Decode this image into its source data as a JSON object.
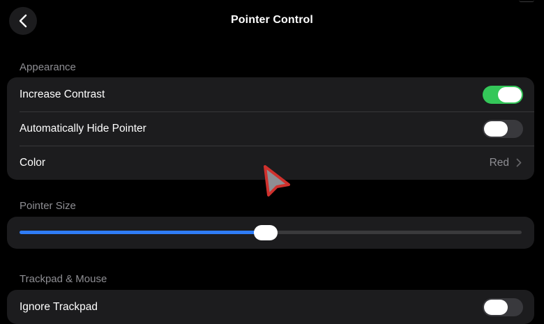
{
  "nav": {
    "title": "Pointer Control",
    "back_icon": "chevron-left-icon"
  },
  "sections": {
    "appearance": {
      "header": "Appearance",
      "increase_contrast": {
        "label": "Increase Contrast",
        "on": true
      },
      "auto_hide_pointer": {
        "label": "Automatically Hide Pointer",
        "on": false
      },
      "color": {
        "label": "Color",
        "value": "Red"
      }
    },
    "pointer_size": {
      "header": "Pointer Size",
      "value_fraction": 0.49
    },
    "trackpad_mouse": {
      "header": "Trackpad & Mouse",
      "ignore_trackpad": {
        "label": "Ignore Trackpad",
        "on": false
      }
    }
  },
  "colors": {
    "toggle_on": "#34c759",
    "toggle_off": "#39393d",
    "slider_fill": "#2f7cf6",
    "pointer_fill": "#8e8e93",
    "pointer_outline": "#d0312d"
  }
}
